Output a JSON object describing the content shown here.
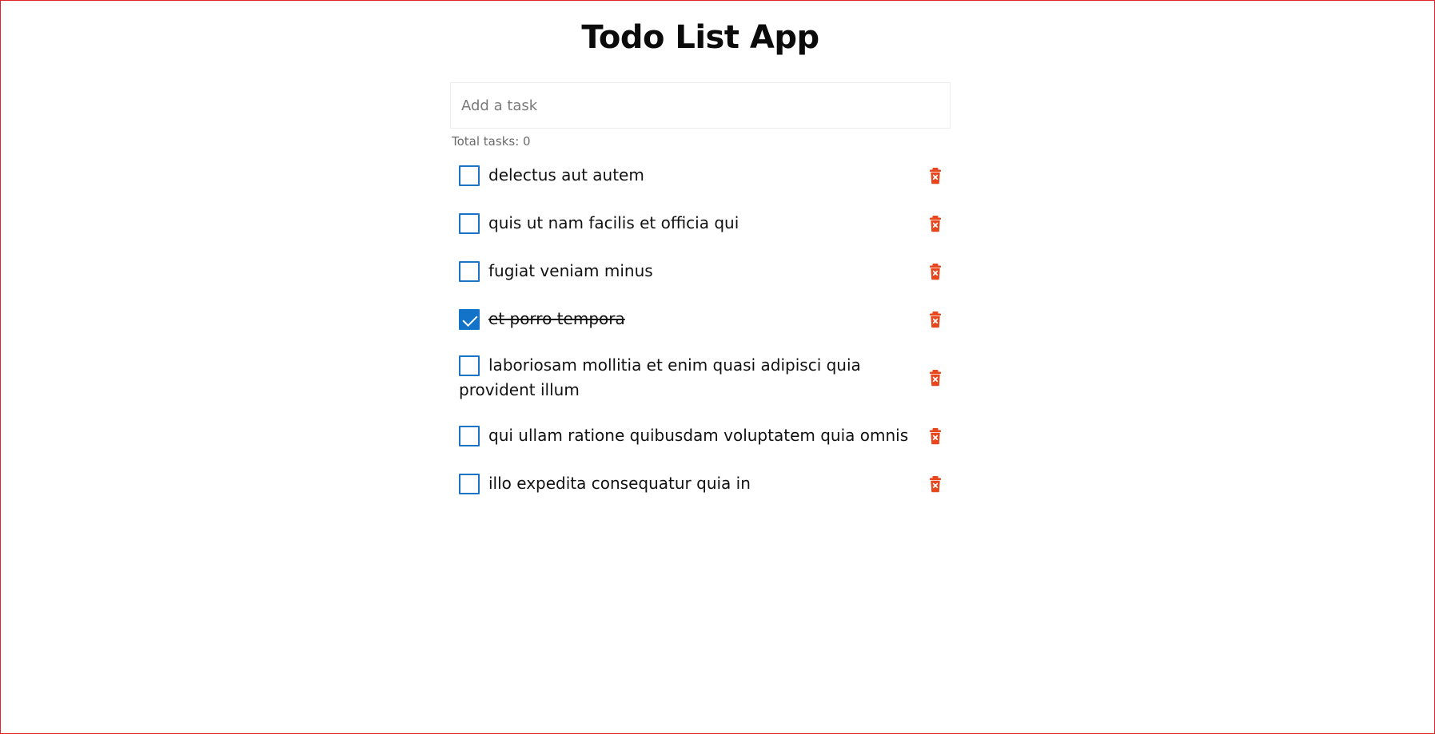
{
  "app": {
    "title": "Todo List App"
  },
  "input": {
    "placeholder": "Add a task",
    "value": ""
  },
  "summary": {
    "total_label": "Total tasks: 0"
  },
  "colors": {
    "checkbox_accent": "#1273c8",
    "delete_icon": "#e8461c",
    "frame_border": "#e0242a"
  },
  "tasks": [
    {
      "text": "delectus aut autem",
      "completed": false,
      "delete_icon": "trash-icon"
    },
    {
      "text": "quis ut nam facilis et officia qui",
      "completed": false,
      "delete_icon": "trash-icon"
    },
    {
      "text": "fugiat veniam minus",
      "completed": false,
      "delete_icon": "trash-icon"
    },
    {
      "text": "et porro tempora",
      "completed": true,
      "delete_icon": "trash-icon"
    },
    {
      "text": "laboriosam mollitia et enim quasi adipisci quia provident illum",
      "completed": false,
      "delete_icon": "trash-icon"
    },
    {
      "text": "qui ullam ratione quibusdam voluptatem quia omnis",
      "completed": false,
      "delete_icon": "trash-icon"
    },
    {
      "text": "illo expedita consequatur quia in",
      "completed": false,
      "delete_icon": "trash-icon"
    }
  ]
}
